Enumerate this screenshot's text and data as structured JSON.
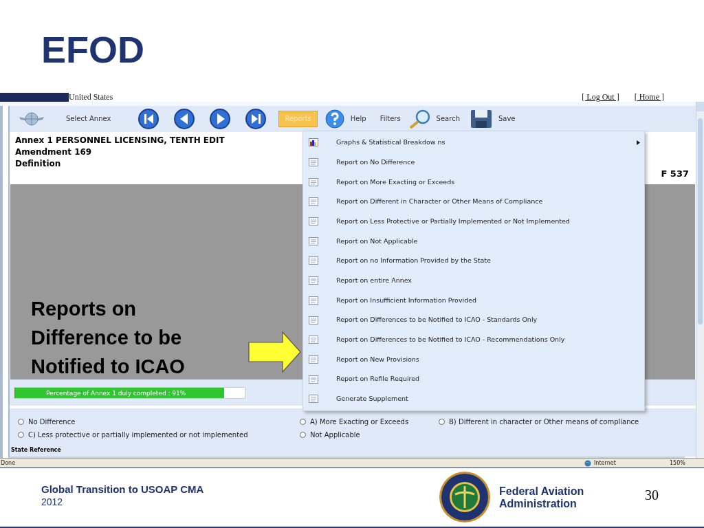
{
  "slide": {
    "title": "EFOD",
    "callout": "Reports on Difference to be Notified to ICAO",
    "footer": {
      "left_title": "Global Transition to USOAP CMA",
      "year": "2012",
      "agency": "Federal Aviation Administration",
      "page_number": "30"
    }
  },
  "app": {
    "state_name": "United States",
    "header_links": [
      "[ Log Out ]",
      "[ Home ]"
    ],
    "toolbar": {
      "select_annex": "Select Annex",
      "reports": {
        "label": "Reports",
        "expanded": true
      },
      "help": "Help",
      "filters": "Filters",
      "search": "Search",
      "save": "Save"
    },
    "document": {
      "lines": [
        "Annex 1 PERSONNEL LICENSING, TENTH EDIT",
        "Amendment 169",
        "Definition"
      ],
      "count": "F 537"
    },
    "progress": {
      "label": "Percentage of Annex 1 duly completed : 91%",
      "level": 0.91
    },
    "options": [
      {
        "label": "No Difference",
        "checked": false
      },
      {
        "label": "A) More Exacting or Exceeds",
        "checked": false
      },
      {
        "label": "B) Different in character or Other means of compliance",
        "checked": false
      },
      {
        "label": "C) Less protective or partially implemented or not implemented",
        "checked": false
      },
      {
        "label": "Not Applicable",
        "checked": false
      }
    ],
    "state_reference": "State Reference",
    "menu": [
      {
        "kind": "graphs",
        "label": "Graphs & Statistical Breakdow ns"
      },
      {
        "kind": "report",
        "label": "Report on No Difference"
      },
      {
        "kind": "report",
        "label": "Report on More Exacting or Exceeds"
      },
      {
        "kind": "report",
        "label": "Report on Different in Character or Other Means of Compliance"
      },
      {
        "kind": "report",
        "label": "Report on Less Protective or Partially Implemented or Not Implemented"
      },
      {
        "kind": "report",
        "label": "Report on Not Applicable"
      },
      {
        "kind": "report",
        "label": "Report on no Information Provided by the State"
      },
      {
        "kind": "report",
        "label": "Report on entire Annex"
      },
      {
        "kind": "report",
        "label": "Report on Insufficient Information Provided"
      },
      {
        "kind": "report",
        "label": "Report on Differences to be Notified to ICAO - Standards Only"
      },
      {
        "kind": "report",
        "label": "Report on Differences to be Notified to ICAO - Recommendations Only"
      },
      {
        "kind": "report",
        "label": "Report on New Provisions"
      },
      {
        "kind": "report",
        "label": "Report on Refile Required"
      },
      {
        "kind": "report",
        "label": "Generate Supplement"
      }
    ],
    "status_bar": {
      "left": "Done",
      "zone": "Internet",
      "zoom": "150%"
    }
  }
}
